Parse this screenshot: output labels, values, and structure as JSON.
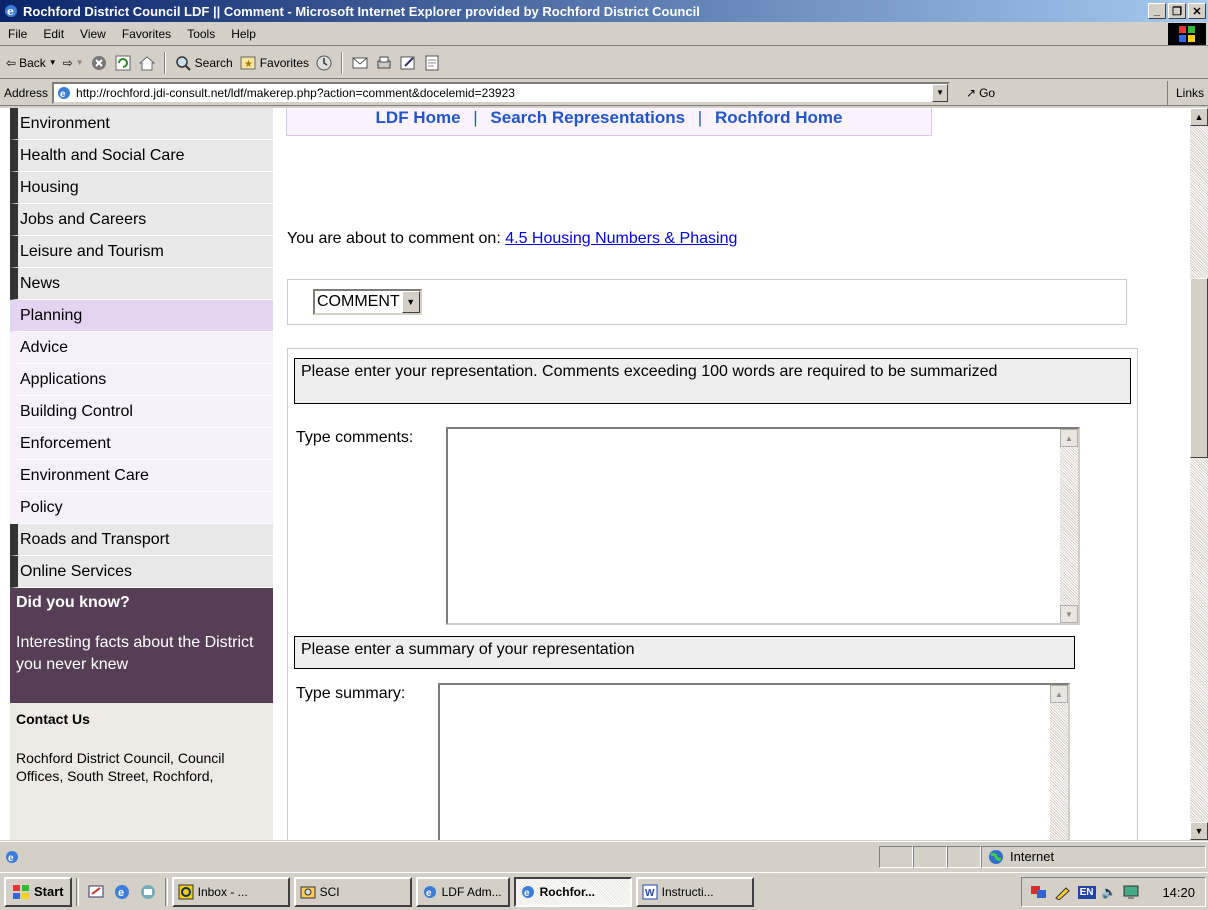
{
  "window": {
    "title": "Rochford District Council LDF || Comment - Microsoft Internet Explorer provided by Rochford District Council"
  },
  "menu": [
    "File",
    "Edit",
    "View",
    "Favorites",
    "Tools",
    "Help"
  ],
  "toolbar": {
    "back": "Back",
    "search": "Search",
    "favorites": "Favorites"
  },
  "address": {
    "label": "Address",
    "url": "http://rochford.jdi-consult.net/ldf/makerep.php?action=comment&docelemid=23923",
    "go": "Go",
    "links": "Links"
  },
  "sidebar": {
    "items": [
      {
        "label": "Environment",
        "kind": "top"
      },
      {
        "label": "Health and Social Care",
        "kind": "top"
      },
      {
        "label": "Housing",
        "kind": "top"
      },
      {
        "label": "Jobs and Careers",
        "kind": "top"
      },
      {
        "label": "Leisure and Tourism",
        "kind": "top"
      },
      {
        "label": "News",
        "kind": "top"
      },
      {
        "label": "Planning",
        "kind": "planning"
      },
      {
        "label": "Advice",
        "kind": "sub"
      },
      {
        "label": "Applications",
        "kind": "sub"
      },
      {
        "label": "Building Control",
        "kind": "sub"
      },
      {
        "label": "Enforcement",
        "kind": "sub"
      },
      {
        "label": "Environment Care",
        "kind": "sub"
      },
      {
        "label": "Policy",
        "kind": "sub"
      },
      {
        "label": "Roads and Transport",
        "kind": "top"
      },
      {
        "label": "Online Services",
        "kind": "top"
      }
    ],
    "did_you_know": {
      "title": "Did you know?",
      "text": "Interesting facts about the District you never knew"
    },
    "contact": {
      "title": "Contact Us",
      "text": "Rochford District Council, Council Offices, South Street, Rochford,"
    }
  },
  "topnav": {
    "ldf_home": "LDF Home",
    "search_reps": "Search Representations",
    "rochford_home": "Rochford Home",
    "separator": "|"
  },
  "main": {
    "intro_prefix": "You are about to comment on:",
    "intro_link": "4.5 Housing Numbers & Phasing",
    "type_select": "COMMENT",
    "rep_instruction": "Please enter your representation. Comments exceeding 100 words are required to be summarized",
    "comments_label": "Type comments:",
    "comments_value": "",
    "summary_instruction": "Please enter a summary of your representation",
    "summary_label": "Type summary:",
    "summary_value": ""
  },
  "status": {
    "zone": "Internet"
  },
  "taskbar": {
    "start": "Start",
    "tasks": [
      {
        "label": "Inbox - ...",
        "active": false
      },
      {
        "label": "SCI",
        "active": false
      },
      {
        "label": "LDF Adm...",
        "active": false
      },
      {
        "label": "Rochfor...",
        "active": true
      },
      {
        "label": "Instructi...",
        "active": false
      }
    ],
    "tray_lang": "EN",
    "clock": "14:20"
  }
}
